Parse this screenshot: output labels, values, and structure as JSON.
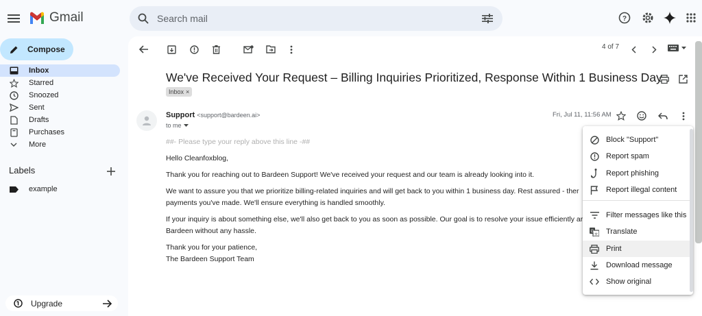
{
  "app": {
    "name": "Gmail"
  },
  "search": {
    "placeholder": "Search mail"
  },
  "sidebar": {
    "compose_label": "Compose",
    "items": [
      {
        "label": "Inbox",
        "icon": "inbox-icon"
      },
      {
        "label": "Starred",
        "icon": "star-icon"
      },
      {
        "label": "Snoozed",
        "icon": "clock-icon"
      },
      {
        "label": "Sent",
        "icon": "send-icon"
      },
      {
        "label": "Drafts",
        "icon": "draft-icon"
      },
      {
        "label": "Purchases",
        "icon": "purchases-icon"
      },
      {
        "label": "More",
        "icon": "chevron-down-icon"
      }
    ],
    "labels_heading": "Labels",
    "labels": [
      {
        "label": "example"
      }
    ],
    "upgrade_label": "Upgrade"
  },
  "toolbar": {
    "pager": "4 of 7"
  },
  "message": {
    "subject": "We've Received Your Request – Billing Inquiries Prioritized, Response Within 1 Business Day",
    "chip": "Inbox",
    "chip_close": "×",
    "sender_name": "Support",
    "sender_email": "<support@bardeen.ai>",
    "to": "to me",
    "date": "Fri, Jul 11, 11:56 AM",
    "body": {
      "reply_line": "##- Please type your reply above this line -##",
      "greeting": "Hello Cleanfoxblog,",
      "p1": "Thank you for reaching out to Bardeen Support! We've received your request and our team is already looking into it.",
      "p2a": "We want to assure you that we prioritize billing-related inquiries and will get back to you within 1 business day. Rest assured - ther",
      "p2b": "payments you've made. We'll ensure everything is handled smoothly.",
      "p3a": "If your inquiry is about something else, we'll also get back to you as soon as possible. Our goal is to resolve your issue efficiently ar",
      "p3b": "Bardeen without any hassle.",
      "signoff1": "Thank you for your patience,",
      "signoff2": "The Bardeen Support Team"
    }
  },
  "menu": {
    "items": [
      {
        "label": "Block \"Support\"",
        "icon": "block-icon"
      },
      {
        "label": "Report spam",
        "icon": "report-icon"
      },
      {
        "label": "Report phishing",
        "icon": "phishing-icon"
      },
      {
        "label": "Report illegal content",
        "icon": "flag-icon"
      },
      {
        "label": "Filter messages like this",
        "icon": "filter-icon"
      },
      {
        "label": "Translate",
        "icon": "translate-icon"
      },
      {
        "label": "Print",
        "icon": "print-icon"
      },
      {
        "label": "Download message",
        "icon": "download-icon"
      },
      {
        "label": "Show original",
        "icon": "code-icon"
      }
    ]
  },
  "colors": {
    "compose_bg": "#c2e7ff",
    "active_nav_bg": "#d3e3fd",
    "gmail_red": "#ea4335"
  }
}
